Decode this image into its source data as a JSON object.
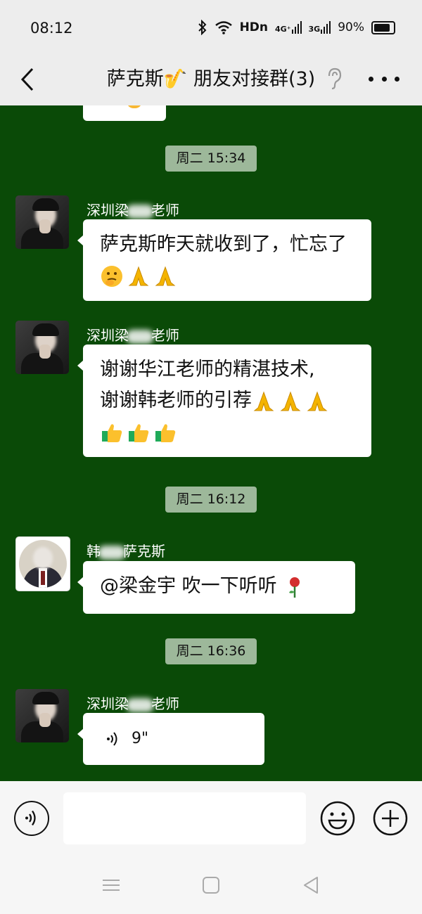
{
  "status_bar": {
    "time": "08:12",
    "hd_label": "HDn",
    "net1": "4G⁺",
    "net2": "3G",
    "battery_text": "90%",
    "battery_level": 0.9
  },
  "header": {
    "title": "萨克斯🎷 朋友对接群(3)"
  },
  "chat": {
    "timestamps": [
      "周二 15:34",
      "周二 16:12",
      "周二 16:36"
    ],
    "messages": [
      {
        "sender_pre": "深圳梁",
        "sender_post": "老师",
        "text": "萨克斯昨天就收到了，忙忘了",
        "emojis": [
          "thinking-face",
          "folded-hands",
          "folded-hands"
        ]
      },
      {
        "sender_pre": "深圳梁",
        "sender_post": "老师",
        "line1": "谢谢华江老师的精湛技术,",
        "line2": "谢谢韩老师的引荐",
        "emojis_inline": [
          "folded-hands",
          "folded-hands",
          "folded-hands"
        ],
        "emojis_row": [
          "thumbs-up",
          "thumbs-up",
          "thumbs-up"
        ]
      },
      {
        "sender_pre": "韩",
        "sender_post": "萨克斯",
        "text": "@梁金宇  吹一下听听",
        "emojis": [
          "rose"
        ]
      },
      {
        "sender_pre": "深圳梁",
        "sender_post": "老师",
        "voice_duration": "9\""
      }
    ]
  },
  "input_bar": {
    "placeholder": ""
  },
  "colors": {
    "chat_background": "#0a4a07",
    "timestamp_bg": "#9db89a",
    "bubble": "#ffffff"
  }
}
